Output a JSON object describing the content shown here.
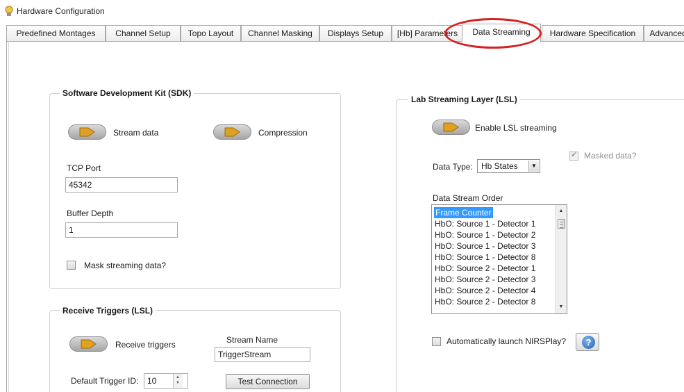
{
  "window": {
    "title": "Hardware Configuration"
  },
  "tabs": [
    {
      "label": "Predefined Montages"
    },
    {
      "label": "Channel Setup"
    },
    {
      "label": "Topo Layout"
    },
    {
      "label": "Channel Masking"
    },
    {
      "label": "Displays Setup"
    },
    {
      "label": "[Hb] Parameters"
    },
    {
      "label": "Data Streaming",
      "active": true
    },
    {
      "label": "Hardware Specification"
    },
    {
      "label": "Advanced"
    }
  ],
  "sdk": {
    "title": "Software Development Kit (SDK)",
    "stream_data_label": "Stream data",
    "compression_label": "Compression",
    "tcp_port_label": "TCP Port",
    "tcp_port_value": "45342",
    "buffer_depth_label": "Buffer Depth",
    "buffer_depth_value": "1",
    "mask_label": "Mask streaming data?"
  },
  "triggers": {
    "title": "Receive Triggers (LSL)",
    "receive_label": "Receive triggers",
    "stream_name_label": "Stream Name",
    "stream_name_value": "TriggerStream",
    "default_id_label": "Default Trigger ID:",
    "default_id_value": "10",
    "test_button": "Test Connection"
  },
  "lsl": {
    "title": "Lab Streaming Layer (LSL)",
    "enable_label": "Enable LSL streaming",
    "masked_label": "Masked data?",
    "data_type_label": "Data Type:",
    "data_type_value": "Hb States",
    "order_label": "Data Stream Order",
    "order_items": [
      "Frame Counter",
      "HbO: Source 1 - Detector 1",
      "HbO: Source 1 - Detector 2",
      "HbO: Source 1 - Detector 3",
      "HbO: Source 1 - Detector 8",
      "HbO: Source 2 - Detector 1",
      "HbO: Source 2 - Detector 3",
      "HbO: Source 2 - Detector 4",
      "HbO: Source 2 - Detector 8"
    ],
    "autolaunch_label": "Automatically launch NIRSPlay?",
    "help_glyph": "?"
  },
  "icons": {
    "app": "lightbulb-icon",
    "toggle_knob": "orange-arrow-knob-icon",
    "help": "help-icon"
  },
  "colors": {
    "selection": "#3399ff",
    "annotation": "#d42121",
    "knob": "#e0a020"
  }
}
